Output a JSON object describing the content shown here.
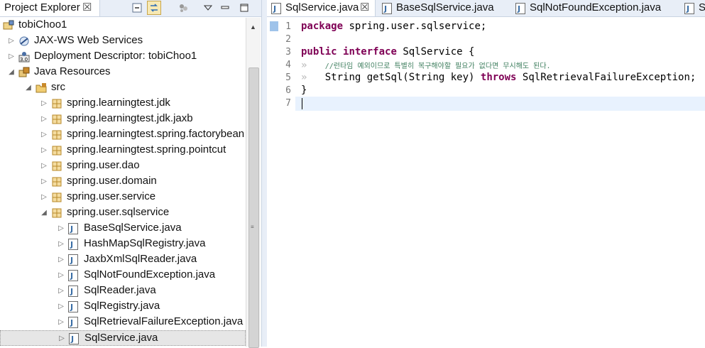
{
  "explorer": {
    "title": "Project Explorer",
    "close": "☒",
    "tree": [
      {
        "label": "tobiChoo1",
        "indent": 0,
        "arrow": "",
        "icon": "project"
      },
      {
        "label": "JAX-WS Web Services",
        "indent": 1,
        "arrow": "▷",
        "icon": "webservices"
      },
      {
        "label": "Deployment Descriptor: tobiChoo1",
        "indent": 1,
        "arrow": "▷",
        "icon": "deploy"
      },
      {
        "label": "Java Resources",
        "indent": 1,
        "arrow": "◢",
        "icon": "javares"
      },
      {
        "label": "src",
        "indent": 2,
        "arrow": "◢",
        "icon": "srcfolder"
      },
      {
        "label": "spring.learningtest.jdk",
        "indent": 3,
        "arrow": "▷",
        "icon": "package"
      },
      {
        "label": "spring.learningtest.jdk.jaxb",
        "indent": 3,
        "arrow": "▷",
        "icon": "package"
      },
      {
        "label": "spring.learningtest.spring.factorybean",
        "indent": 3,
        "arrow": "▷",
        "icon": "package"
      },
      {
        "label": "spring.learningtest.spring.pointcut",
        "indent": 3,
        "arrow": "▷",
        "icon": "package"
      },
      {
        "label": "spring.user.dao",
        "indent": 3,
        "arrow": "▷",
        "icon": "package"
      },
      {
        "label": "spring.user.domain",
        "indent": 3,
        "arrow": "▷",
        "icon": "package"
      },
      {
        "label": "spring.user.service",
        "indent": 3,
        "arrow": "▷",
        "icon": "package"
      },
      {
        "label": "spring.user.sqlservice",
        "indent": 3,
        "arrow": "◢",
        "icon": "package"
      },
      {
        "label": "BaseSqlService.java",
        "indent": 4,
        "arrow": "▷",
        "icon": "javafile"
      },
      {
        "label": "HashMapSqlRegistry.java",
        "indent": 4,
        "arrow": "▷",
        "icon": "javafile"
      },
      {
        "label": "JaxbXmlSqlReader.java",
        "indent": 4,
        "arrow": "▷",
        "icon": "javafile"
      },
      {
        "label": "SqlNotFoundException.java",
        "indent": 4,
        "arrow": "▷",
        "icon": "javafile"
      },
      {
        "label": "SqlReader.java",
        "indent": 4,
        "arrow": "▷",
        "icon": "javafile"
      },
      {
        "label": "SqlRegistry.java",
        "indent": 4,
        "arrow": "▷",
        "icon": "javafile"
      },
      {
        "label": "SqlRetrievalFailureException.java",
        "indent": 4,
        "arrow": "▷",
        "icon": "javafile"
      },
      {
        "label": "SqlService.java",
        "indent": 4,
        "arrow": "▷",
        "icon": "javafile",
        "selected": true
      }
    ]
  },
  "editor": {
    "tabs": [
      {
        "label": "SqlService.java",
        "close": "☒",
        "active": true
      },
      {
        "label": "BaseSqlService.java"
      },
      {
        "label": "SqlNotFoundException.java"
      },
      {
        "label": "S"
      }
    ],
    "line_numbers": [
      "1",
      "2",
      "3",
      "4",
      "5",
      "6",
      "7"
    ],
    "code": {
      "l1_kw": "package",
      "l1_rest": "spring.user.sqlservice;",
      "l3_kw1": "public",
      "l3_kw2": "interface",
      "l3_rest": "SqlService {",
      "l4_ws": "»",
      "l4_comment": "//런타임 예외이므로 특별히 복구해야할 필요가 없다면 무시해도 된다.",
      "l5_ws": "»",
      "l5_a": "String getSql(String key)",
      "l5_kw": "throws",
      "l5_b": "SqlRetrievalFailureException;",
      "l6": "}"
    }
  },
  "colors": {
    "keyword": "#7f0055",
    "comment": "#3f7f5f",
    "line_highlight": "#e8f2fe",
    "tab_bg": "#e8eef7"
  }
}
